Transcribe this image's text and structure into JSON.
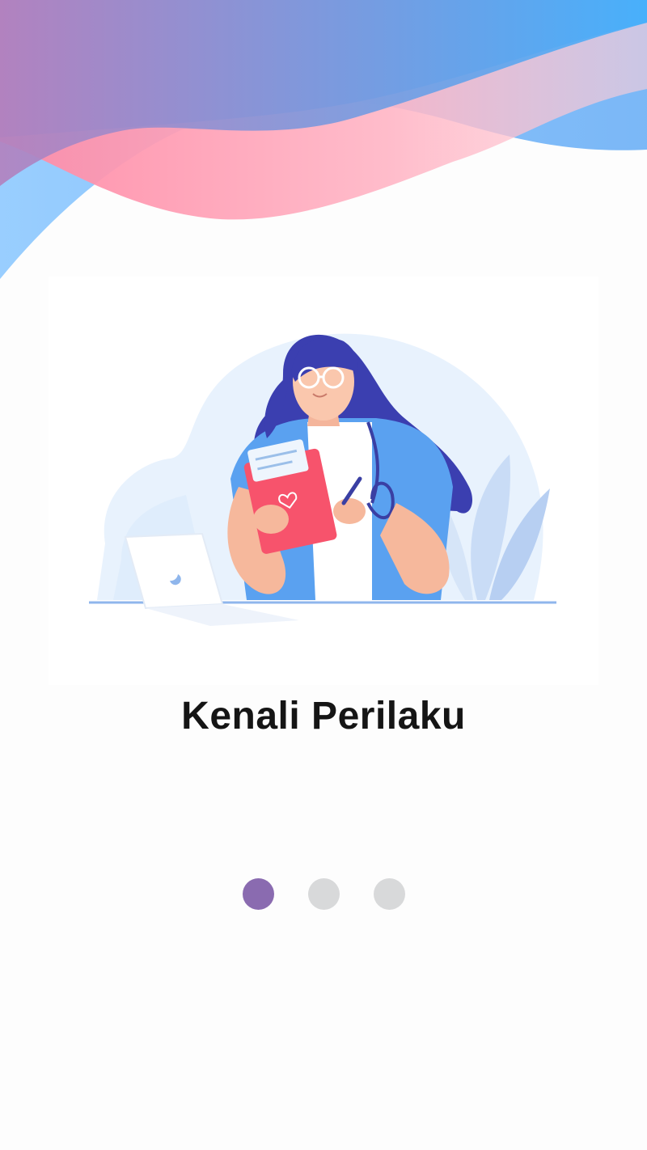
{
  "onboarding": {
    "title": "Kenali Perilaku",
    "illustration": "doctor-with-clipboard-illustration",
    "page_indicator": {
      "total": 3,
      "active_index": 0
    }
  },
  "colors": {
    "wave_gradient_start": "#b67fbd",
    "wave_gradient_end": "#4fb1fb",
    "wave_pink": "#ff9fb5",
    "active_dot": "#8a6bb0",
    "inactive_dot": "#d8d9da",
    "title": "#151515"
  }
}
